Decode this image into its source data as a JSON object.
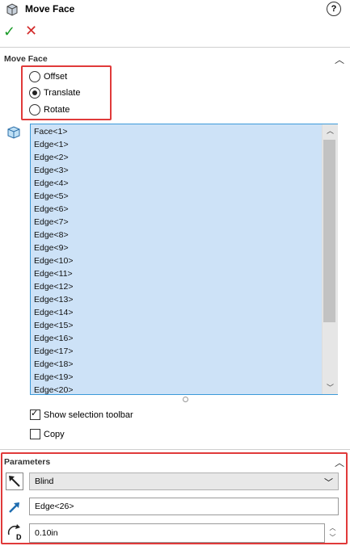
{
  "header": {
    "title": "Move Face",
    "help": "?"
  },
  "actions": {
    "ok": "✓",
    "cancel": "✕"
  },
  "move_face_section": {
    "label": "Move Face",
    "options": [
      "Offset",
      "Translate",
      "Rotate"
    ],
    "selected": "Translate"
  },
  "selection": {
    "items": [
      "Face<1>",
      "Edge<1>",
      "Edge<2>",
      "Edge<3>",
      "Edge<4>",
      "Edge<5>",
      "Edge<6>",
      "Edge<7>",
      "Edge<8>",
      "Edge<9>",
      "Edge<10>",
      "Edge<11>",
      "Edge<12>",
      "Edge<13>",
      "Edge<14>",
      "Edge<15>",
      "Edge<16>",
      "Edge<17>",
      "Edge<18>",
      "Edge<19>",
      "Edge<20>"
    ],
    "show_toolbar_label": "Show selection toolbar",
    "show_toolbar_checked": true,
    "copy_label": "Copy",
    "copy_checked": false
  },
  "parameters": {
    "label": "Parameters",
    "end_condition": "Blind",
    "direction": "Edge<26>",
    "distance": "0.10in"
  },
  "colors": {
    "highlight": "#e03a3a",
    "list_bg": "#cde2f7",
    "list_border": "#3c9ad9"
  }
}
